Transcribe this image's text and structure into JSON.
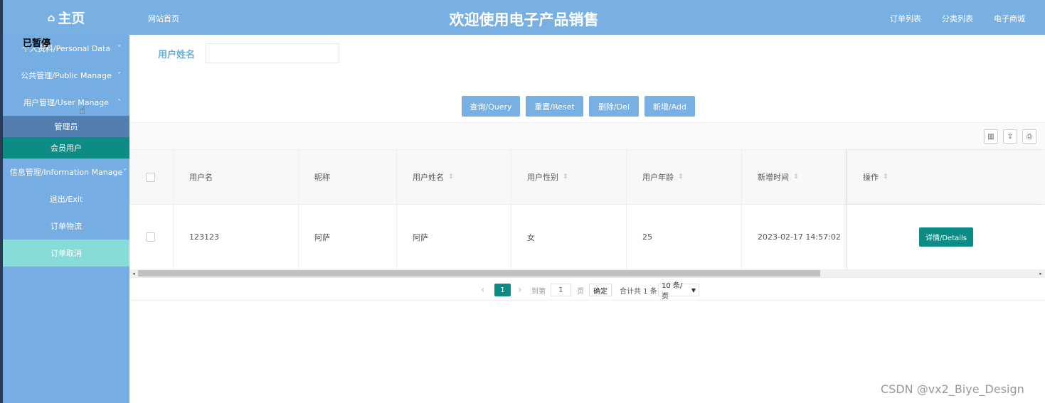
{
  "header": {
    "brand": "主页",
    "home_icon": "home-icon",
    "site_home_link": "网站首页",
    "title": "欢迎使用电子产品销售",
    "links": [
      "订单列表",
      "分类列表",
      "电子商城"
    ]
  },
  "overlay": {
    "paused_label": "已暂停"
  },
  "sidebar": {
    "items": [
      {
        "label": "个人资料/Personal Data",
        "chevron": "˅"
      },
      {
        "label": "公共管理/Public Manage",
        "chevron": "˅"
      },
      {
        "label": "用户管理/User Manage",
        "chevron": "˄"
      }
    ],
    "submenu": [
      {
        "label": "管理员"
      },
      {
        "label": "会员用户"
      }
    ],
    "items_after": [
      {
        "label": "信息管理/Information Manage",
        "chevron": "˅"
      },
      {
        "label": "退出/Exit"
      },
      {
        "label": "订单物流"
      },
      {
        "label": "订单取消"
      }
    ]
  },
  "search": {
    "label": "用户姓名",
    "value": ""
  },
  "buttons": {
    "query": "查询/Query",
    "reset": "重置/Reset",
    "delete": "删除/Del",
    "add": "新增/Add"
  },
  "table": {
    "headers": [
      "用户名",
      "昵称",
      "用户姓名",
      "用户性别",
      "用户年龄",
      "新增时间",
      "操作"
    ],
    "sort_icon": "⇕",
    "rows": [
      {
        "username": "123123",
        "nickname": "阿萨",
        "realname": "阿萨",
        "gender": "女",
        "age": "25",
        "created": "2023-02-17 14:57:02",
        "action": "详情/Details"
      }
    ]
  },
  "pagination": {
    "prev": "‹",
    "current": "1",
    "next": "›",
    "goto_label": "到第",
    "goto_value": "1",
    "page_unit": "页",
    "confirm": "确定",
    "total": "合计共 1 条",
    "page_size": "10 条/页"
  },
  "watermark": "CSDN @vx2_Biye_Design",
  "colors": {
    "header_bg": "#79b0e3",
    "sidebar_bg": "#76aee3",
    "accent_teal": "#0d8c86",
    "highlight_item": "#87dbd8"
  }
}
